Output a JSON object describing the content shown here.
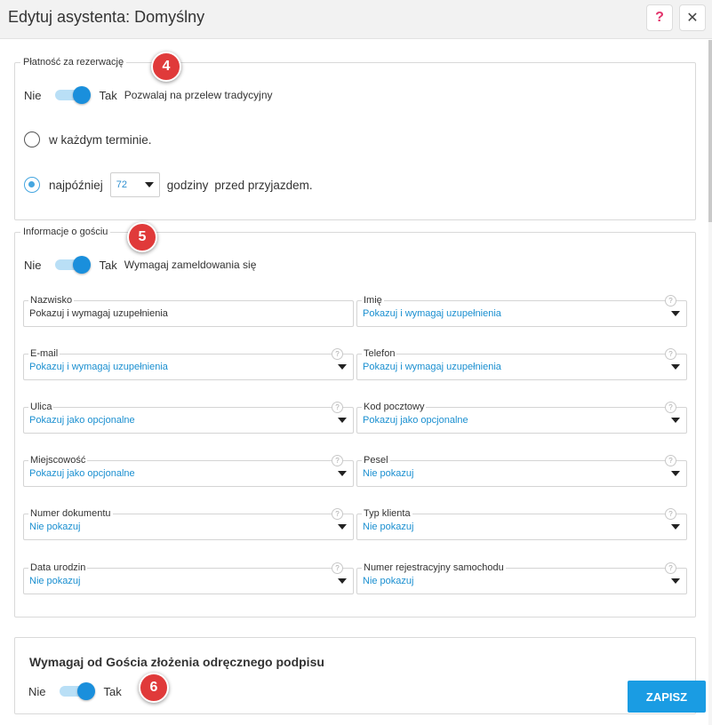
{
  "header": {
    "title": "Edytuj asystenta: Domyślny",
    "help_icon": "?",
    "close_icon": "✕"
  },
  "payment": {
    "legend": "Płatność za rezerwację",
    "badge": "4",
    "toggle": {
      "off_label": "Nie",
      "on_label": "Tak",
      "description": "Pozwalaj na przelew tradycyjny",
      "state": true
    },
    "radio_any": {
      "label": "w każdym terminie.",
      "checked": false
    },
    "radio_latest": {
      "label_before": "najpóźniej",
      "hours_value": "72",
      "label_after1": "godziny",
      "label_after2": "przed przyjazdem.",
      "checked": true
    }
  },
  "guest_info": {
    "legend": "Informacje o gościu",
    "badge": "5",
    "toggle": {
      "off_label": "Nie",
      "on_label": "Tak",
      "description": "Wymagaj zameldowania się",
      "state": true
    },
    "fields": [
      {
        "label": "Nazwisko",
        "value": "Pokazuj i wymagaj uzupełnienia"
      },
      {
        "label": "Imię",
        "value": "Pokazuj i wymagaj uzupełnienia"
      },
      {
        "label": "E-mail",
        "value": "Pokazuj i wymagaj uzupełnienia"
      },
      {
        "label": "Telefon",
        "value": "Pokazuj i wymagaj uzupełnienia"
      },
      {
        "label": "Ulica",
        "value": "Pokazuj jako opcjonalne"
      },
      {
        "label": "Kod pocztowy",
        "value": "Pokazuj jako opcjonalne"
      },
      {
        "label": "Miejscowość",
        "value": "Pokazuj jako opcjonalne"
      },
      {
        "label": "Pesel",
        "value": "Nie pokazuj"
      },
      {
        "label": "Numer dokumentu",
        "value": "Nie pokazuj"
      },
      {
        "label": "Typ klienta",
        "value": "Nie pokazuj"
      },
      {
        "label": "Data urodzin",
        "value": "Nie pokazuj"
      },
      {
        "label": "Numer rejestracyjny samochodu",
        "value": "Nie pokazuj"
      }
    ]
  },
  "signature": {
    "title": "Wymagaj od Gościa złożenia odręcznego podpisu",
    "badge": "6",
    "toggle": {
      "off_label": "Nie",
      "on_label": "Tak",
      "state": true
    }
  },
  "save_button": {
    "label": "ZAPISZ"
  },
  "colors": {
    "accent": "#1a9ce3",
    "badge": "#e03a3a",
    "link_value": "#1a8fd0"
  }
}
